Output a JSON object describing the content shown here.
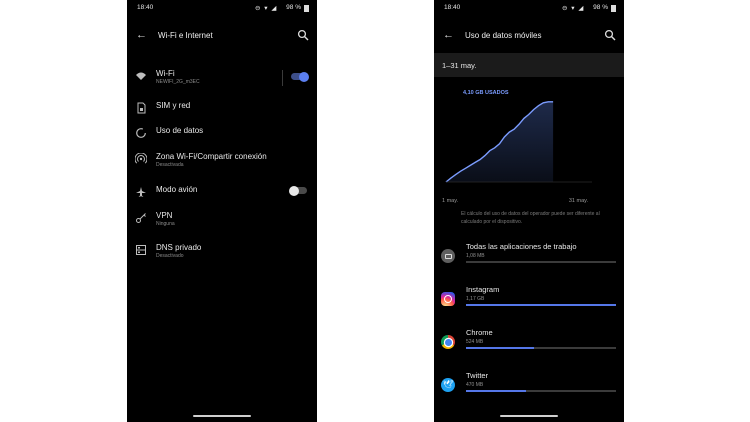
{
  "left": {
    "status": {
      "time": "18:40",
      "battery": "98 %"
    },
    "title": "Wi-Fi e Internet",
    "items": [
      {
        "label": "Wi-Fi",
        "sub": "NEWIFI_2G_m3EC",
        "icon": "wifi-icon",
        "toggle": "on"
      },
      {
        "label": "SIM y red",
        "sub": "",
        "icon": "sim-icon"
      },
      {
        "label": "Uso de datos",
        "sub": "",
        "icon": "data-usage-icon"
      },
      {
        "label": "Zona Wi-Fi/Compartir conexión",
        "sub": "Desactivada",
        "icon": "hotspot-icon"
      },
      {
        "label": "Modo avión",
        "sub": "",
        "icon": "airplane-icon",
        "toggle": "off"
      },
      {
        "label": "VPN",
        "sub": "Ninguna",
        "icon": "vpn-key-icon"
      },
      {
        "label": "DNS privado",
        "sub": "Desactivado",
        "icon": "dns-icon"
      }
    ]
  },
  "right": {
    "status": {
      "time": "18:40",
      "battery": "98 %"
    },
    "title": "Uso de datos móviles",
    "range": "1–31 may.",
    "chart_data": {
      "type": "area",
      "title": "",
      "annotation": "4,10 GB USADOS",
      "x_tick_labels": [
        "1 may.",
        "31 may."
      ],
      "x": [
        1,
        2,
        3,
        4,
        5,
        6,
        7,
        8,
        9,
        10,
        11,
        12,
        13,
        14,
        15,
        16,
        17,
        18,
        19,
        20,
        21,
        22,
        23
      ],
      "y": [
        0.0,
        0.2,
        0.38,
        0.55,
        0.7,
        0.85,
        1.0,
        1.15,
        1.35,
        1.6,
        1.75,
        1.95,
        2.3,
        2.55,
        2.7,
        2.95,
        3.25,
        3.45,
        3.7,
        3.9,
        4.05,
        4.1,
        4.1
      ],
      "ylim": [
        0,
        4.6
      ],
      "xlim": [
        1,
        31
      ],
      "color": "#7b9cff",
      "grid": false
    },
    "note": "El cálculo del uso de datos del operador puede ser diferente al calculado por el dispositivo.",
    "apps": [
      {
        "name": "Todas las aplicaciones de trabajo",
        "size": "1,08 MB",
        "icon": "work-briefcase-icon",
        "fraction": 0.0,
        "color": "#9e9e9e"
      },
      {
        "name": "Instagram",
        "size": "1,17 GB",
        "icon": "instagram-icon",
        "fraction": 1.0,
        "color": "#d6249f"
      },
      {
        "name": "Chrome",
        "size": "524 MB",
        "icon": "chrome-icon",
        "fraction": 0.45,
        "color": "#ffffff"
      },
      {
        "name": "Twitter",
        "size": "470 MB",
        "icon": "twitter-icon",
        "fraction": 0.4,
        "color": "#1da1f2"
      }
    ]
  }
}
